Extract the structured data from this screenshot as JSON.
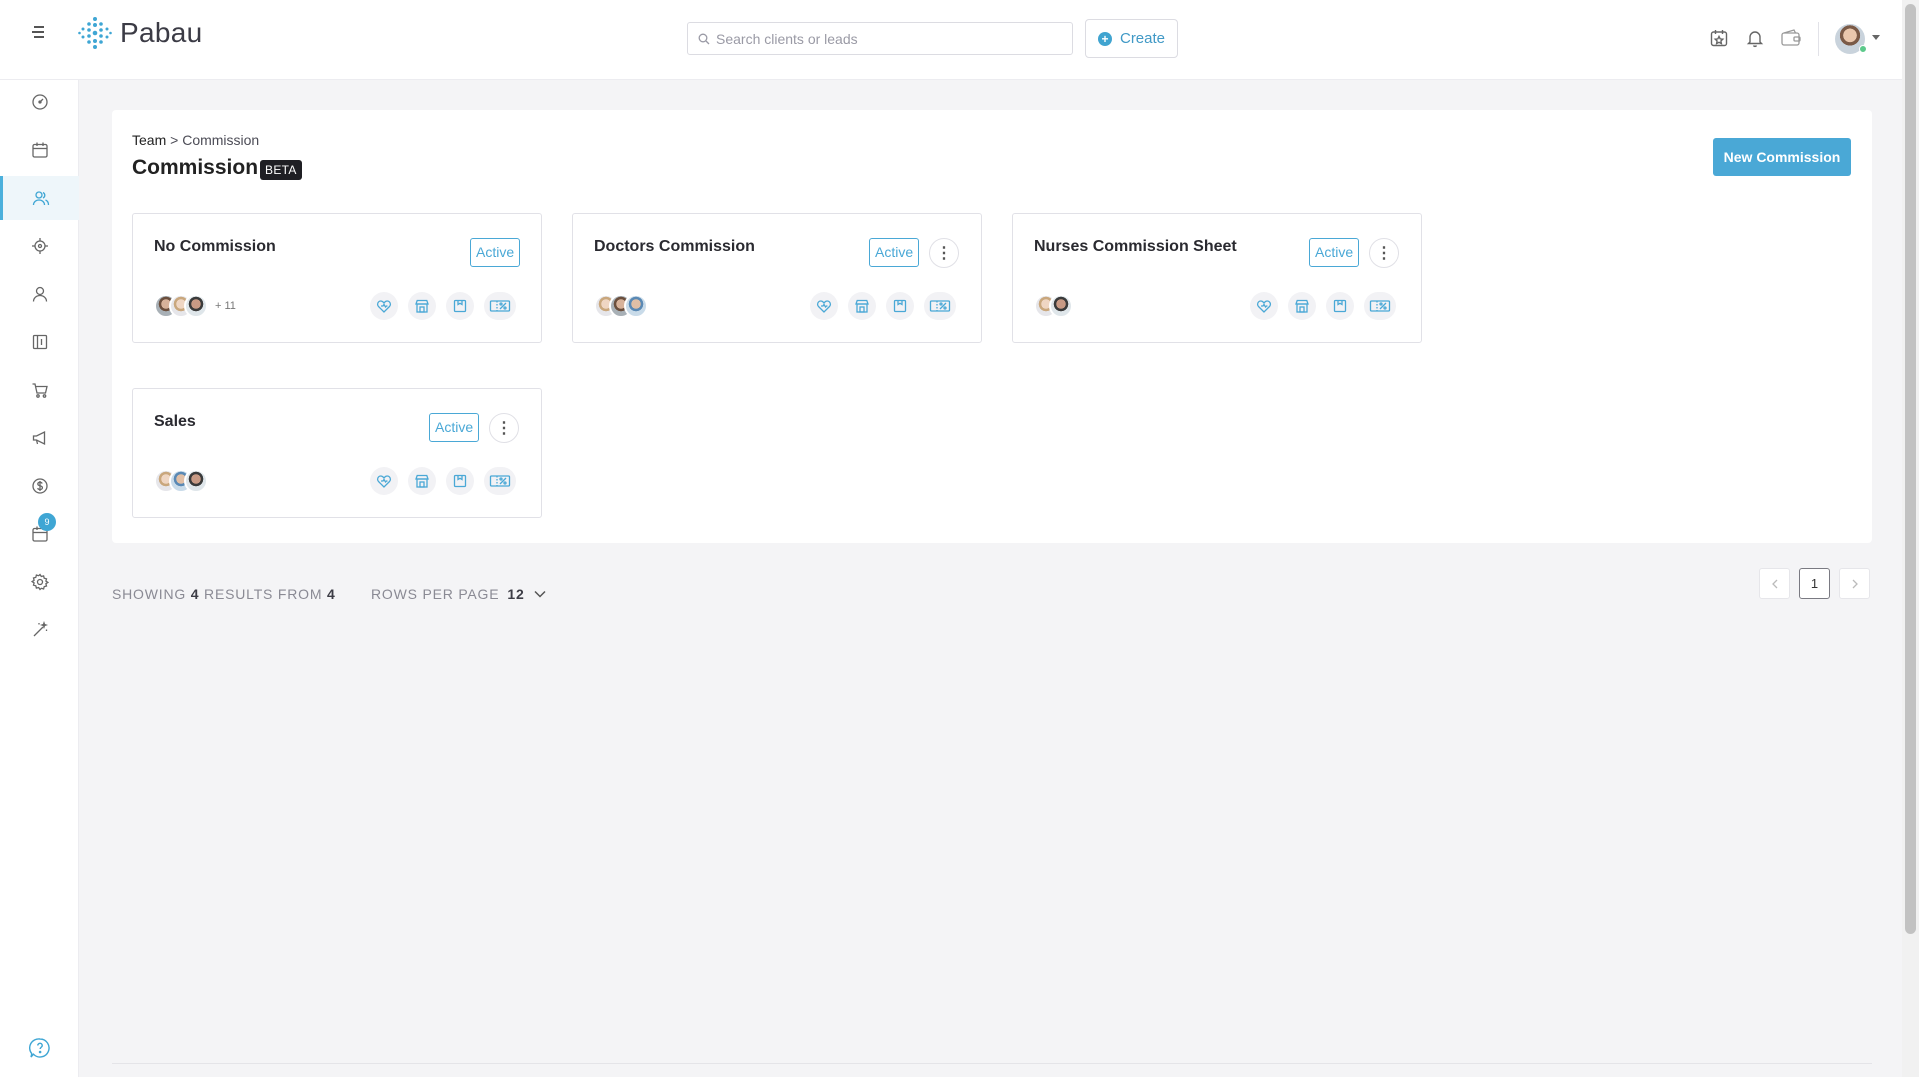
{
  "header": {
    "logo_text": "Pabau",
    "search_placeholder": "Search clients or leads",
    "create_label": "Create",
    "top_icons": [
      "calendar-star-icon",
      "bell-icon",
      "wallet-icon"
    ]
  },
  "sidebar": {
    "items": [
      {
        "name": "dashboard-icon"
      },
      {
        "name": "calendar-icon"
      },
      {
        "name": "team-icon",
        "active": true
      },
      {
        "name": "leads-target-icon"
      },
      {
        "name": "user-icon"
      },
      {
        "name": "reports-icon"
      },
      {
        "name": "cart-icon"
      },
      {
        "name": "megaphone-icon"
      },
      {
        "name": "dollar-icon"
      },
      {
        "name": "calendar-check-icon",
        "badge": "9"
      },
      {
        "name": "settings-icon"
      },
      {
        "name": "magic-wand-icon"
      }
    ],
    "help_icon": "help-icon"
  },
  "page": {
    "breadcrumb_parent": "Team",
    "breadcrumb_sep": ">",
    "breadcrumb_current": "Commission",
    "title": "Commission",
    "title_badge": "BETA",
    "new_button": "New Commission"
  },
  "cards": [
    {
      "title": "No Commission",
      "status": "Active",
      "more_count": "+ 11",
      "has_menu": false
    },
    {
      "title": "Doctors Commission",
      "status": "Active",
      "more_count": "",
      "has_menu": true
    },
    {
      "title": "Nurses Commission Sheet",
      "status": "Active",
      "more_count": "",
      "has_menu": true
    },
    {
      "title": "Sales",
      "status": "Active",
      "more_count": "",
      "has_menu": true
    }
  ],
  "card_icons": [
    "services-heart-icon",
    "store-icon",
    "package-icon",
    "discount-ticket-icon"
  ],
  "footer": {
    "showing_label": "SHOWING",
    "showing_count": "4",
    "results_from_label": "RESULTS FROM",
    "total": "4",
    "rows_per_page_label": "ROWS PER PAGE",
    "rows_per_page_value": "12",
    "current_page": "1"
  },
  "colors": {
    "accent": "#4aa8d6",
    "background": "#f4f4f6"
  }
}
